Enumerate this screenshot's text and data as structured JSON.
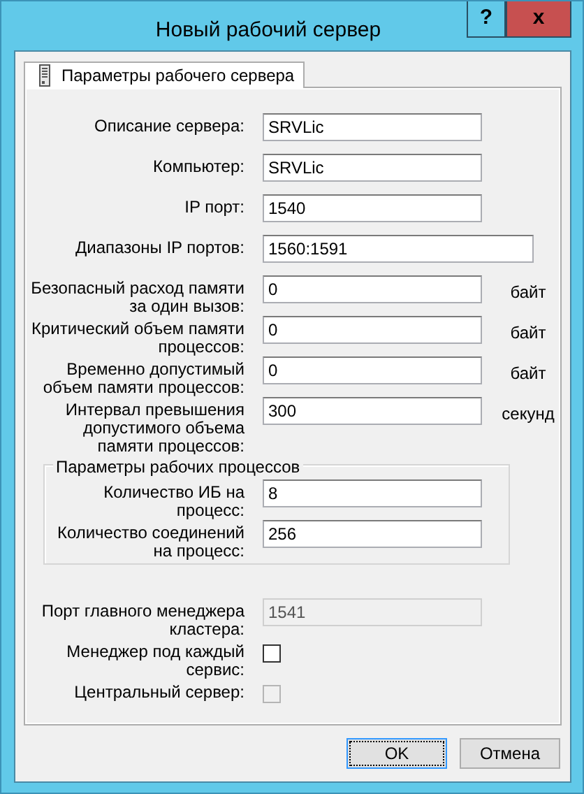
{
  "window": {
    "title": "Новый рабочий сервер",
    "title_buttons": [
      {
        "kind": "help",
        "label": "?"
      },
      {
        "kind": "close",
        "label": "x"
      }
    ]
  },
  "tabs": [
    {
      "label": "Параметры рабочего сервера",
      "selected": true
    }
  ],
  "fields": [
    {
      "kind": "text",
      "label": "Описание сервера:",
      "value": "SRVLic"
    },
    {
      "kind": "text",
      "label": "Компьютер:",
      "value": "SRVLic"
    },
    {
      "kind": "text",
      "label": "IP порт:",
      "value": "1540"
    },
    {
      "kind": "text-wide",
      "label": "Диапазоны IP портов:",
      "value": "1560:1591"
    },
    {
      "kind": "text",
      "label": "Безопасный расход памяти за один вызов:",
      "value": "0",
      "unit": "байт"
    },
    {
      "kind": "text",
      "label": "Критический объем памяти процессов:",
      "value": "0",
      "unit": "байт"
    },
    {
      "kind": "text",
      "label": "Временно допустимый объем памяти процессов:",
      "value": "0",
      "unit": "байт"
    },
    {
      "kind": "text",
      "label": "Интервал превышения допустимого объема памяти процессов:",
      "value": "300",
      "unit": "секунд"
    }
  ],
  "group": {
    "title": "Параметры рабочих процессов",
    "fields": [
      {
        "kind": "text",
        "label": "Количество ИБ на процесс:",
        "value": "8"
      },
      {
        "kind": "text",
        "label": "Количество соединений на процесс:",
        "value": "256"
      }
    ]
  },
  "fields_after": [
    {
      "kind": "text-disabled",
      "label": "Порт главного менеджера кластера:",
      "value": "1541"
    },
    {
      "kind": "checkbox",
      "label": "Менеджер под каждый сервис:",
      "checked": false,
      "disabled": false
    },
    {
      "kind": "checkbox",
      "label": "Центральный сервер:",
      "checked": false,
      "disabled": true
    }
  ],
  "buttons": [
    {
      "label": "OK",
      "default": true
    },
    {
      "label": "Отмена",
      "default": false
    }
  ]
}
